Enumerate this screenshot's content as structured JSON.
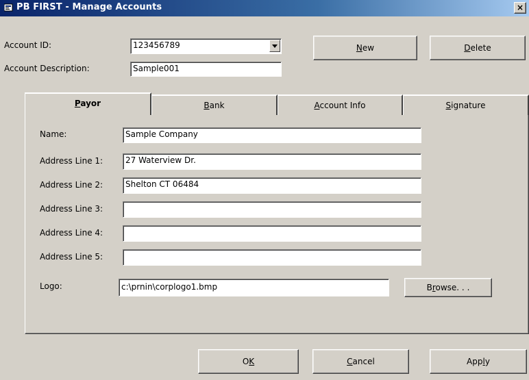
{
  "window": {
    "title": "PB FIRST - Manage Accounts",
    "close_label": "×"
  },
  "header": {
    "account_id_label": "Account ID:",
    "account_id_value": "123456789",
    "account_desc_label": "Account Description:",
    "account_desc_value": "Sample001",
    "new_pre": "",
    "new_key": "N",
    "new_post": "ew",
    "delete_pre": "",
    "delete_key": "D",
    "delete_post": "elete"
  },
  "tabs": [
    {
      "pre": "",
      "key": "P",
      "post": "ayor"
    },
    {
      "pre": "",
      "key": "B",
      "post": "ank"
    },
    {
      "pre": "",
      "key": "A",
      "post": "ccount Info"
    },
    {
      "pre": "",
      "key": "S",
      "post": "ignature"
    }
  ],
  "payor": {
    "name_label": "Name:",
    "name_value": "Sample Company",
    "addr1_label": "Address Line 1:",
    "addr1_value": "27 Waterview Dr.",
    "addr2_label": "Address Line 2:",
    "addr2_value": "Shelton CT 06484",
    "addr3_label": "Address Line 3:",
    "addr3_value": "",
    "addr4_label": "Address Line 4:",
    "addr4_value": "",
    "addr5_label": "Address Line 5:",
    "addr5_value": "",
    "logo_label": "Logo:",
    "logo_value": "c:\\prnin\\corplogo1.bmp",
    "browse_pre": "B",
    "browse_key": "r",
    "browse_post": "owse. . ."
  },
  "footer": {
    "ok_pre": "O",
    "ok_key": "K",
    "ok_post": "",
    "cancel_pre": "",
    "cancel_key": "C",
    "cancel_post": "ancel",
    "apply_pre": "App",
    "apply_key": "l",
    "apply_post": "y"
  },
  "colors": {
    "titlebar_start": "#0a246a",
    "face": "#d4d0c8"
  }
}
